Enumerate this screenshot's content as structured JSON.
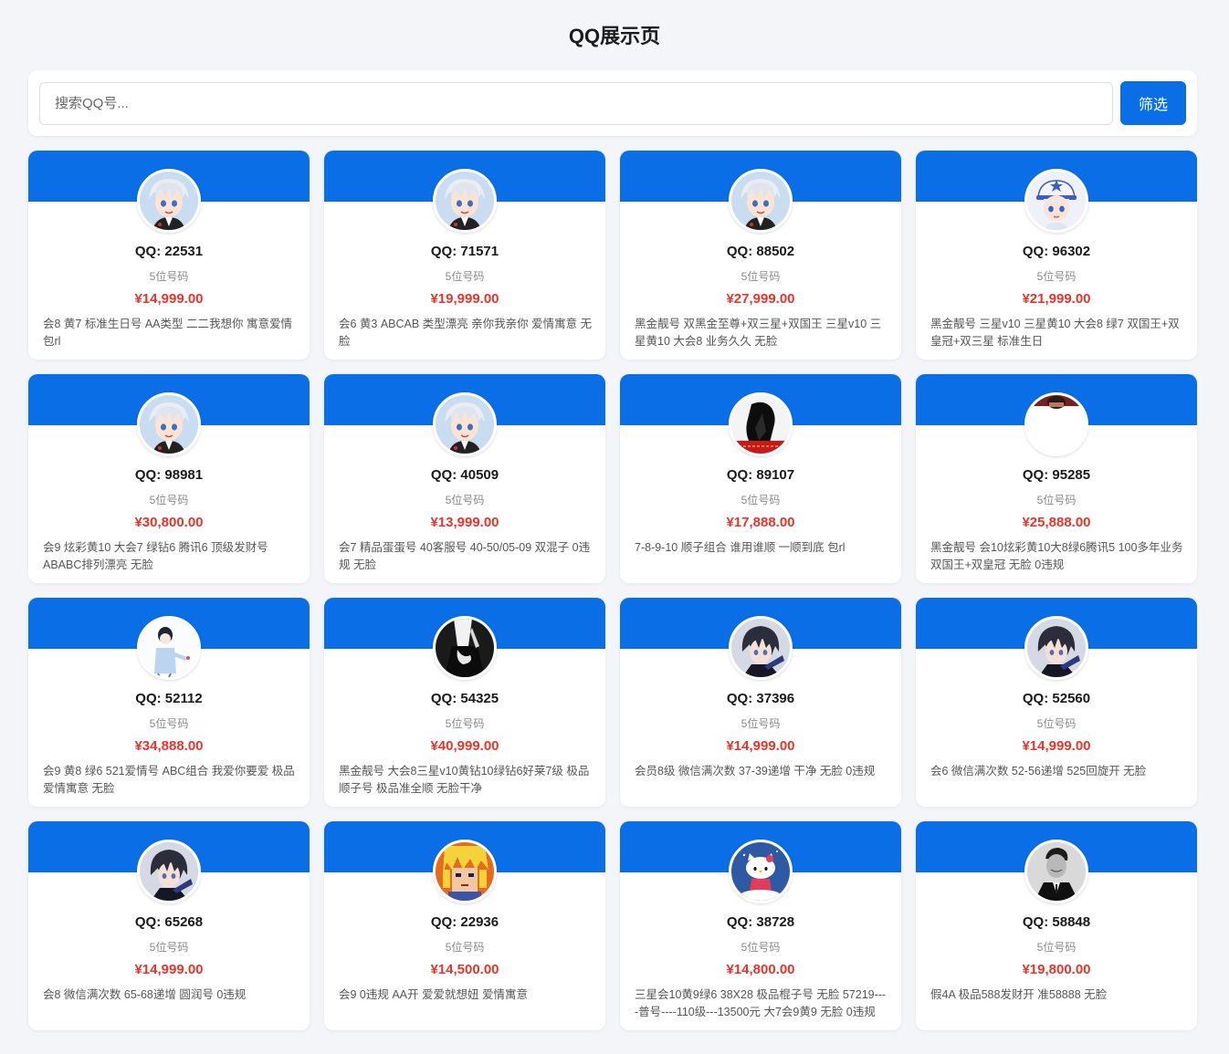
{
  "page_title": "QQ展示页",
  "search": {
    "placeholder": "搜索QQ号..."
  },
  "filter_label": "筛选",
  "colors": {
    "accent": "#0a6fe6",
    "price": "#e6352b",
    "background": "#f4f5f8"
  },
  "cards": [
    {
      "qq": "QQ: 22531",
      "digits": "5位号码",
      "price": "¥14,999.00",
      "desc": "会8 黄7 标准生日号 AA类型 二二我想你 寓意爱情 包rl",
      "avatar": "anime-boy-white-hair"
    },
    {
      "qq": "QQ: 71571",
      "digits": "5位号码",
      "price": "¥19,999.00",
      "desc": "会6 黄3 ABCAB 类型漂亮 亲你我亲你 爱情寓意 无脸",
      "avatar": "anime-boy-white-hair"
    },
    {
      "qq": "QQ: 88502",
      "digits": "5位号码",
      "price": "¥27,999.00",
      "desc": "黑金靓号 双黑金至尊+双三星+双国王 三星v10 三星黄10 大会8 业务久久 无脸",
      "avatar": "anime-boy-white-hair"
    },
    {
      "qq": "QQ: 96302",
      "digits": "5位号码",
      "price": "¥21,999.00",
      "desc": "黑金靓号 三星v10 三星黄10 大会8 绿7 双国王+双皇冠+双三星 标准生日",
      "avatar": "anime-boy-cap"
    },
    {
      "qq": "QQ: 98981",
      "digits": "5位号码",
      "price": "¥30,800.00",
      "desc": "会9 炫彩黄10 大会7 绿钻6 腾讯6 顶级发财号 ABABC排列漂亮 无脸",
      "avatar": "anime-boy-white-hair"
    },
    {
      "qq": "QQ: 40509",
      "digits": "5位号码",
      "price": "¥13,999.00",
      "desc": "会7 精品蛋蛋号 40客服号 40-50/05-09 双混子 0违规 无脸",
      "avatar": "anime-boy-white-hair"
    },
    {
      "qq": "QQ: 89107",
      "digits": "5位号码",
      "price": "¥17,888.00",
      "desc": "7-8-9-10 顺子组合 谁用谁顺 一顺到底 包rl",
      "avatar": "dark-figure-red"
    },
    {
      "qq": "QQ: 95285",
      "digits": "5位号码",
      "price": "¥25,888.00",
      "desc": "黑金靓号 会10炫彩黄10大8绿6腾讯5 100多年业务 双国王+双皇冠 无脸 0违规",
      "avatar": "partial-photo"
    },
    {
      "qq": "QQ: 52112",
      "digits": "5位号码",
      "price": "¥34,888.00",
      "desc": "会9 黄8 绿6 521爱情号 ABC组合 我爱你要爱 极品爱情寓意 无脸",
      "avatar": "sketch-boy"
    },
    {
      "qq": "QQ: 54325",
      "digits": "5位号码",
      "price": "¥40,999.00",
      "desc": "黑金靓号 大会8三星v10黄钻10绿钻6好莱7级 极品顺子号 极品准全顺 无脸干净",
      "avatar": "dark-hands"
    },
    {
      "qq": "QQ: 37396",
      "digits": "5位号码",
      "price": "¥14,999.00",
      "desc": "会员8级 微信满次数 37-39递增 干净 无脸 0违规",
      "avatar": "anime-dark-hair"
    },
    {
      "qq": "QQ: 52560",
      "digits": "5位号码",
      "price": "¥14,999.00",
      "desc": "会6 微信满次数 52-56递增 525回旋开 无脸",
      "avatar": "anime-dark-hair"
    },
    {
      "qq": "QQ: 65268",
      "digits": "5位号码",
      "price": "¥14,999.00",
      "desc": "会8 微信满次数 65-68递增 圆润号 0违规",
      "avatar": "anime-dark-hair"
    },
    {
      "qq": "QQ: 22936",
      "digits": "5位号码",
      "price": "¥14,500.00",
      "desc": "会9 0违规 AA开 爱爱就想妞 爱情寓意",
      "avatar": "pixel-blonde"
    },
    {
      "qq": "QQ: 38728",
      "digits": "5位号码",
      "price": "¥14,800.00",
      "desc": "三星会10黄9绿6 38X28 极品棍子号 无脸 57219----普号----110级---13500元 大7会9黄9 无脸 0违规",
      "avatar": "kitty-blue"
    },
    {
      "qq": "QQ: 58848",
      "digits": "5位号码",
      "price": "¥19,800.00",
      "desc": "假4A 极品588发财开 准58888 无脸",
      "avatar": "bw-man"
    }
  ]
}
